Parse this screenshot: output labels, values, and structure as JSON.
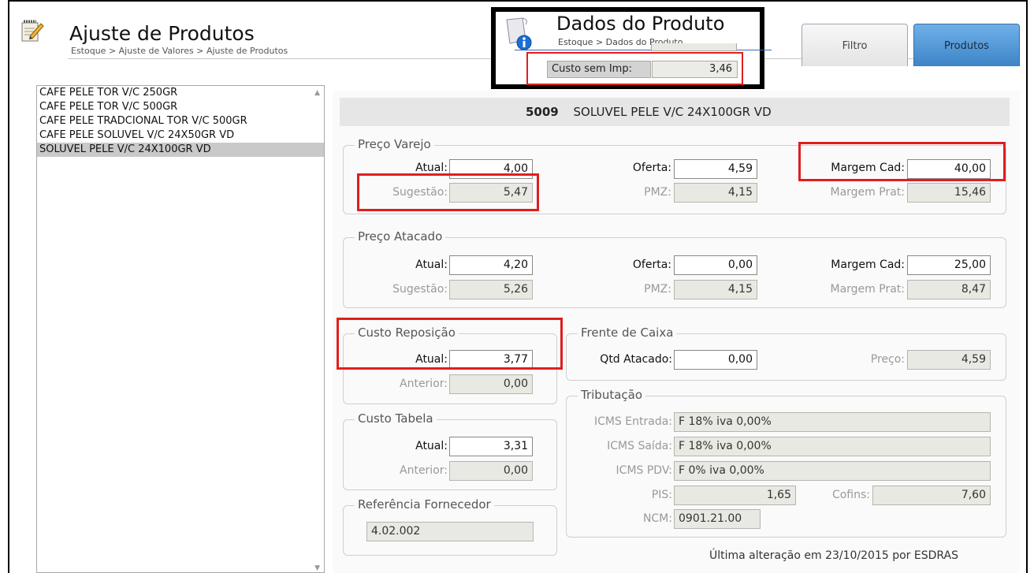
{
  "app": {
    "title": "Ajuste de Produtos",
    "breadcrumb": "Estoque > Ajuste de Valores > Ajuste de Produtos"
  },
  "tabs": [
    {
      "label": "Filtro",
      "active": false
    },
    {
      "label": "Produtos",
      "active": true
    }
  ],
  "popup": {
    "title": "Dados do Produto",
    "breadcrumb": "Estoque > Dados do Produto",
    "custo_label": "Custo sem Imp:",
    "custo_value": "3,46"
  },
  "products": [
    "CAFE PELE TOR V/C 250GR",
    "CAFE PELE TOR V/C 500GR",
    "CAFE PELE TRADCIONAL TOR V/C 500GR",
    "CAFE PELE SOLUVEL V/C 24X50GR VD",
    "SOLUVEL PELE V/C 24X100GR VD"
  ],
  "selected_product": {
    "code": "5009",
    "name": "SOLUVEL PELE V/C 24X100GR VD"
  },
  "preco_varejo": {
    "legend": "Preço Varejo",
    "atual_label": "Atual:",
    "atual": "4,00",
    "sugestao_label": "Sugestão:",
    "sugestao": "5,47",
    "oferta_label": "Oferta:",
    "oferta": "4,59",
    "pmz_label": "PMZ:",
    "pmz": "4,15",
    "margem_cad_label": "Margem Cad:",
    "margem_cad": "40,00",
    "margem_prat_label": "Margem Prat:",
    "margem_prat": "15,46"
  },
  "preco_atacado": {
    "legend": "Preço Atacado",
    "atual_label": "Atual:",
    "atual": "4,20",
    "sugestao_label": "Sugestão:",
    "sugestao": "5,26",
    "oferta_label": "Oferta:",
    "oferta": "0,00",
    "pmz_label": "PMZ:",
    "pmz": "4,15",
    "margem_cad_label": "Margem Cad:",
    "margem_cad": "25,00",
    "margem_prat_label": "Margem Prat:",
    "margem_prat": "8,47"
  },
  "custo_reposicao": {
    "legend": "Custo Reposição",
    "atual_label": "Atual:",
    "atual": "3,77",
    "anterior_label": "Anterior:",
    "anterior": "0,00"
  },
  "custo_tabela": {
    "legend": "Custo Tabela",
    "atual_label": "Atual:",
    "atual": "3,31",
    "anterior_label": "Anterior:",
    "anterior": "0,00"
  },
  "referencia_fornecedor": {
    "legend": "Referência Fornecedor",
    "value": "4.02.002"
  },
  "frente_caixa": {
    "legend": "Frente de Caixa",
    "qtd_label": "Qtd Atacado:",
    "qtd": "0,00",
    "preco_label": "Preço:",
    "preco": "4,59"
  },
  "tributacao": {
    "legend": "Tributação",
    "icms_entrada_label": "ICMS Entrada:",
    "icms_entrada": "F 18% iva 0,00%",
    "icms_saida_label": "ICMS Saída:",
    "icms_saida": "F 18% iva 0,00%",
    "icms_pdv_label": "ICMS PDV:",
    "icms_pdv": "F 0% iva 0,00%",
    "pis_label": "PIS:",
    "pis": "1,65",
    "cofins_label": "Cofins:",
    "cofins": "7,60",
    "ncm_label": "NCM:",
    "ncm": "0901.21.00"
  },
  "footer": "Última alteração em 23/10/2015 por ESDRAS",
  "colors": {
    "highlight_red": "#e01e1e",
    "active_tab": "#3d85c8"
  }
}
